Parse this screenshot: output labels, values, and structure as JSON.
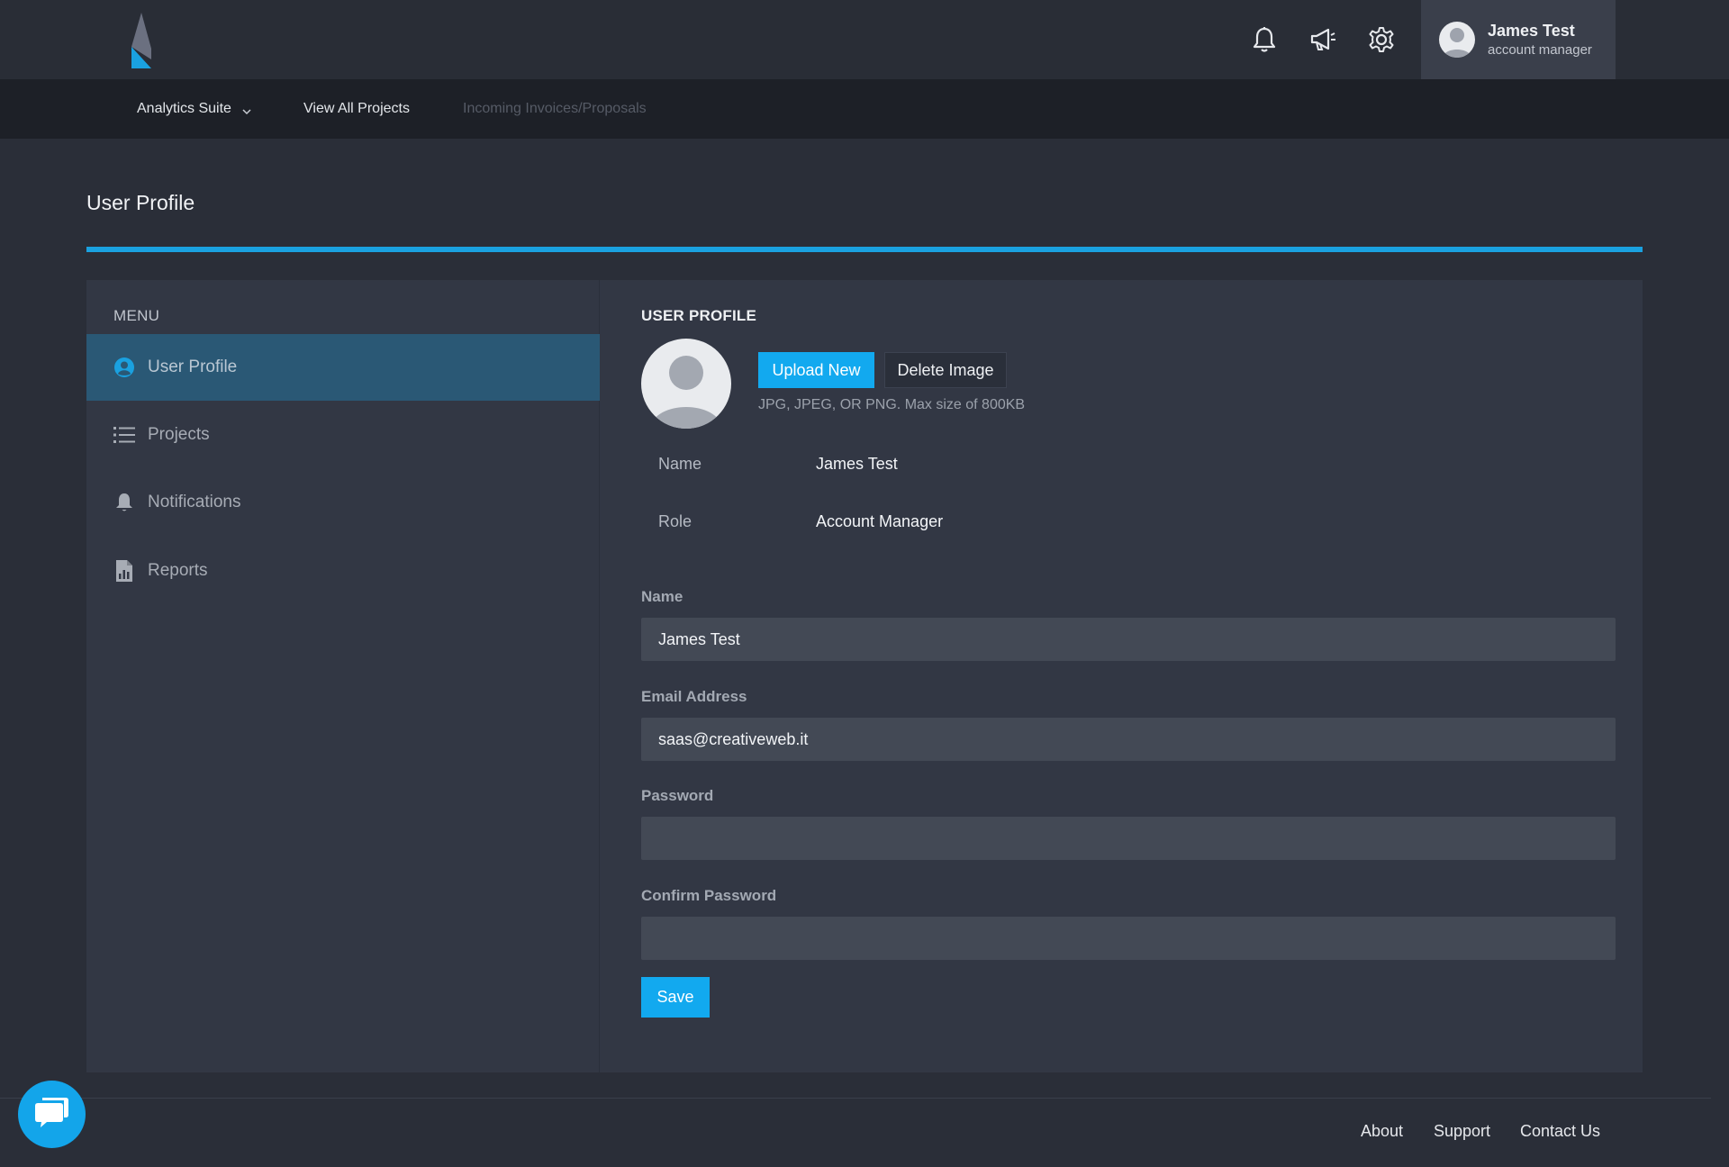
{
  "colors": {
    "accent": "#1aa1e0",
    "primary_button": "#12a9ef",
    "active_menu": "#2a5875",
    "background": "#2a2e38",
    "card": "#323744"
  },
  "header": {
    "logo_icon": "brand-logo",
    "icons": [
      "bell-icon",
      "megaphone-icon",
      "gear-icon"
    ],
    "user": {
      "name": "James Test",
      "role": "account manager"
    }
  },
  "subnav": {
    "items": [
      {
        "label": "Analytics Suite",
        "has_dropdown": true
      },
      {
        "label": "View All Projects"
      },
      {
        "label": "Incoming Invoices/Proposals",
        "disabled": true
      }
    ]
  },
  "page": {
    "title": "User Profile"
  },
  "sidebar": {
    "menu_title": "MENU",
    "items": [
      {
        "label": "User Profile",
        "icon": "user-circle-icon",
        "active": true
      },
      {
        "label": "Projects",
        "icon": "list-icon"
      },
      {
        "label": "Notifications",
        "icon": "bell-icon"
      },
      {
        "label": "Reports",
        "icon": "report-file-icon"
      }
    ]
  },
  "profile": {
    "section_title": "USER PROFILE",
    "upload_label": "Upload New",
    "delete_label": "Delete Image",
    "image_hint": "JPG, JPEG, OR PNG. Max size of 800KB",
    "info": [
      {
        "label": "Name",
        "value": "James Test"
      },
      {
        "label": "Role",
        "value": "Account Manager"
      }
    ]
  },
  "form": {
    "name_label": "Name",
    "name_value": "James Test",
    "email_label": "Email Address",
    "email_value": "saas@creativeweb.it",
    "password_label": "Password",
    "password_value": "",
    "confirm_label": "Confirm Password",
    "confirm_value": "",
    "save_label": "Save"
  },
  "footer": {
    "links": [
      "About",
      "Support",
      "Contact Us"
    ]
  }
}
